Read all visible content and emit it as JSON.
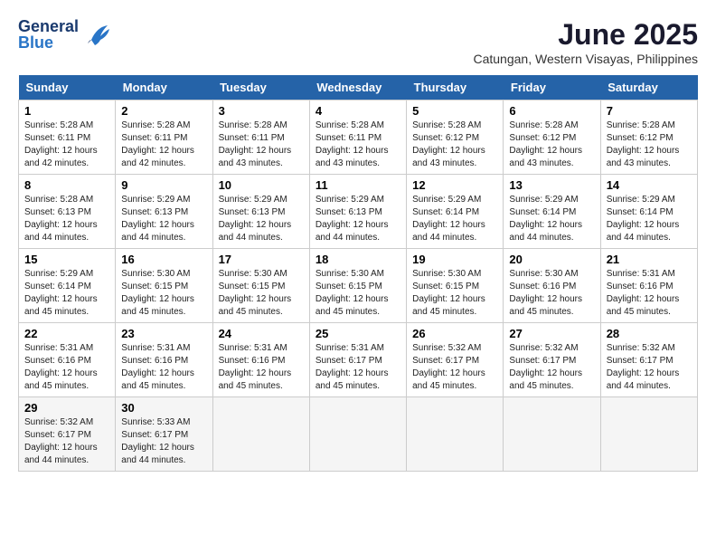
{
  "header": {
    "logo_line1": "General",
    "logo_line2": "Blue",
    "month": "June 2025",
    "location": "Catungan, Western Visayas, Philippines"
  },
  "weekdays": [
    "Sunday",
    "Monday",
    "Tuesday",
    "Wednesday",
    "Thursday",
    "Friday",
    "Saturday"
  ],
  "weeks": [
    [
      {
        "day": 1,
        "sunrise": "5:28 AM",
        "sunset": "6:11 PM",
        "daylight": "12 hours and 42 minutes."
      },
      {
        "day": 2,
        "sunrise": "5:28 AM",
        "sunset": "6:11 PM",
        "daylight": "12 hours and 42 minutes."
      },
      {
        "day": 3,
        "sunrise": "5:28 AM",
        "sunset": "6:11 PM",
        "daylight": "12 hours and 43 minutes."
      },
      {
        "day": 4,
        "sunrise": "5:28 AM",
        "sunset": "6:11 PM",
        "daylight": "12 hours and 43 minutes."
      },
      {
        "day": 5,
        "sunrise": "5:28 AM",
        "sunset": "6:12 PM",
        "daylight": "12 hours and 43 minutes."
      },
      {
        "day": 6,
        "sunrise": "5:28 AM",
        "sunset": "6:12 PM",
        "daylight": "12 hours and 43 minutes."
      },
      {
        "day": 7,
        "sunrise": "5:28 AM",
        "sunset": "6:12 PM",
        "daylight": "12 hours and 43 minutes."
      }
    ],
    [
      {
        "day": 8,
        "sunrise": "5:28 AM",
        "sunset": "6:13 PM",
        "daylight": "12 hours and 44 minutes."
      },
      {
        "day": 9,
        "sunrise": "5:29 AM",
        "sunset": "6:13 PM",
        "daylight": "12 hours and 44 minutes."
      },
      {
        "day": 10,
        "sunrise": "5:29 AM",
        "sunset": "6:13 PM",
        "daylight": "12 hours and 44 minutes."
      },
      {
        "day": 11,
        "sunrise": "5:29 AM",
        "sunset": "6:13 PM",
        "daylight": "12 hours and 44 minutes."
      },
      {
        "day": 12,
        "sunrise": "5:29 AM",
        "sunset": "6:14 PM",
        "daylight": "12 hours and 44 minutes."
      },
      {
        "day": 13,
        "sunrise": "5:29 AM",
        "sunset": "6:14 PM",
        "daylight": "12 hours and 44 minutes."
      },
      {
        "day": 14,
        "sunrise": "5:29 AM",
        "sunset": "6:14 PM",
        "daylight": "12 hours and 44 minutes."
      }
    ],
    [
      {
        "day": 15,
        "sunrise": "5:29 AM",
        "sunset": "6:14 PM",
        "daylight": "12 hours and 45 minutes."
      },
      {
        "day": 16,
        "sunrise": "5:30 AM",
        "sunset": "6:15 PM",
        "daylight": "12 hours and 45 minutes."
      },
      {
        "day": 17,
        "sunrise": "5:30 AM",
        "sunset": "6:15 PM",
        "daylight": "12 hours and 45 minutes."
      },
      {
        "day": 18,
        "sunrise": "5:30 AM",
        "sunset": "6:15 PM",
        "daylight": "12 hours and 45 minutes."
      },
      {
        "day": 19,
        "sunrise": "5:30 AM",
        "sunset": "6:15 PM",
        "daylight": "12 hours and 45 minutes."
      },
      {
        "day": 20,
        "sunrise": "5:30 AM",
        "sunset": "6:16 PM",
        "daylight": "12 hours and 45 minutes."
      },
      {
        "day": 21,
        "sunrise": "5:31 AM",
        "sunset": "6:16 PM",
        "daylight": "12 hours and 45 minutes."
      }
    ],
    [
      {
        "day": 22,
        "sunrise": "5:31 AM",
        "sunset": "6:16 PM",
        "daylight": "12 hours and 45 minutes."
      },
      {
        "day": 23,
        "sunrise": "5:31 AM",
        "sunset": "6:16 PM",
        "daylight": "12 hours and 45 minutes."
      },
      {
        "day": 24,
        "sunrise": "5:31 AM",
        "sunset": "6:16 PM",
        "daylight": "12 hours and 45 minutes."
      },
      {
        "day": 25,
        "sunrise": "5:31 AM",
        "sunset": "6:17 PM",
        "daylight": "12 hours and 45 minutes."
      },
      {
        "day": 26,
        "sunrise": "5:32 AM",
        "sunset": "6:17 PM",
        "daylight": "12 hours and 45 minutes."
      },
      {
        "day": 27,
        "sunrise": "5:32 AM",
        "sunset": "6:17 PM",
        "daylight": "12 hours and 45 minutes."
      },
      {
        "day": 28,
        "sunrise": "5:32 AM",
        "sunset": "6:17 PM",
        "daylight": "12 hours and 44 minutes."
      }
    ],
    [
      {
        "day": 29,
        "sunrise": "5:32 AM",
        "sunset": "6:17 PM",
        "daylight": "12 hours and 44 minutes."
      },
      {
        "day": 30,
        "sunrise": "5:33 AM",
        "sunset": "6:17 PM",
        "daylight": "12 hours and 44 minutes."
      },
      null,
      null,
      null,
      null,
      null
    ]
  ]
}
